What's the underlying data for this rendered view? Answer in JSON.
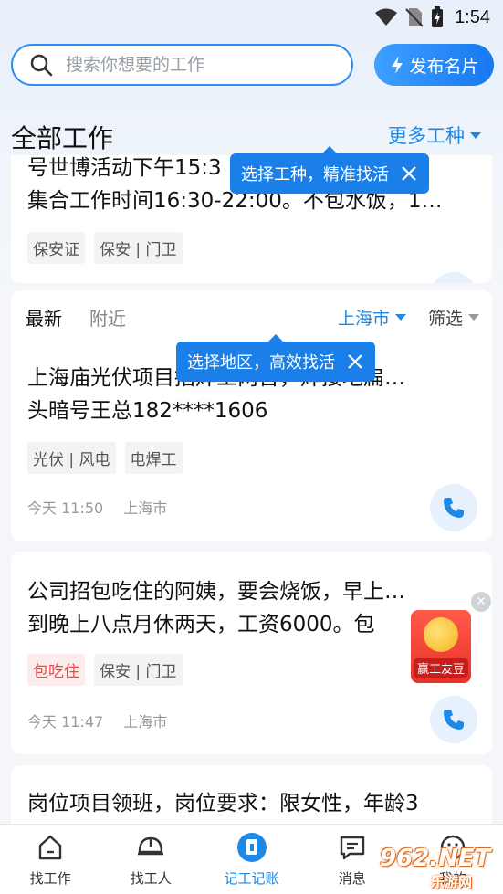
{
  "status_bar": {
    "time": "1:54"
  },
  "search": {
    "placeholder": "搜索你想要的工作"
  },
  "publish_button": {
    "label": "发布名片"
  },
  "section": {
    "title": "全部工作",
    "more_types": "更多工种"
  },
  "tooltips": {
    "type_tip": "选择工种，精准找活",
    "region_tip": "选择地区，高效找活"
  },
  "card1": {
    "line1": "号世博活动下午15:3",
    "line2": "集合工作时间16:30-22:00。不包水饭，1…",
    "tags": [
      "保安证",
      "保安 | 门卫"
    ]
  },
  "filters": {
    "latest": "最新",
    "nearby": "附近",
    "city": "上海市",
    "filter": "筛选"
  },
  "jobs": [
    {
      "line1": "上海庙光伏项目招焊工两台，焊接地扁…",
      "line2": "头暗号王总182****1606",
      "tags": [
        "光伏 | 风电",
        "电焊工"
      ],
      "time": "今天 11:50",
      "city": "上海市"
    },
    {
      "line1": "公司招包吃住的阿姨，要会烧饭，早上…",
      "line2": "到晚上八点月休两天，工资6000。包",
      "tags": [
        "包吃住",
        "保安 | 门卫"
      ],
      "time": "今天 11:47",
      "city": "上海市"
    },
    {
      "line1": "岗位项目领班，岗位要求：限女性，年龄3"
    }
  ],
  "float_ad": {
    "label": "赢工友豆"
  },
  "tabbar": {
    "items": [
      {
        "label": "找工作",
        "icon": "home-icon"
      },
      {
        "label": "找工人",
        "icon": "helmet-icon"
      },
      {
        "label": "记工记账",
        "icon": "ledger-icon"
      },
      {
        "label": "消息",
        "icon": "message-icon"
      },
      {
        "label": "我的",
        "icon": "smile-icon"
      }
    ]
  },
  "watermark": {
    "text": "962.NET",
    "sub": "乐游网"
  },
  "colors": {
    "accent": "#1e88e5",
    "tag_red": "#e54b4b"
  }
}
